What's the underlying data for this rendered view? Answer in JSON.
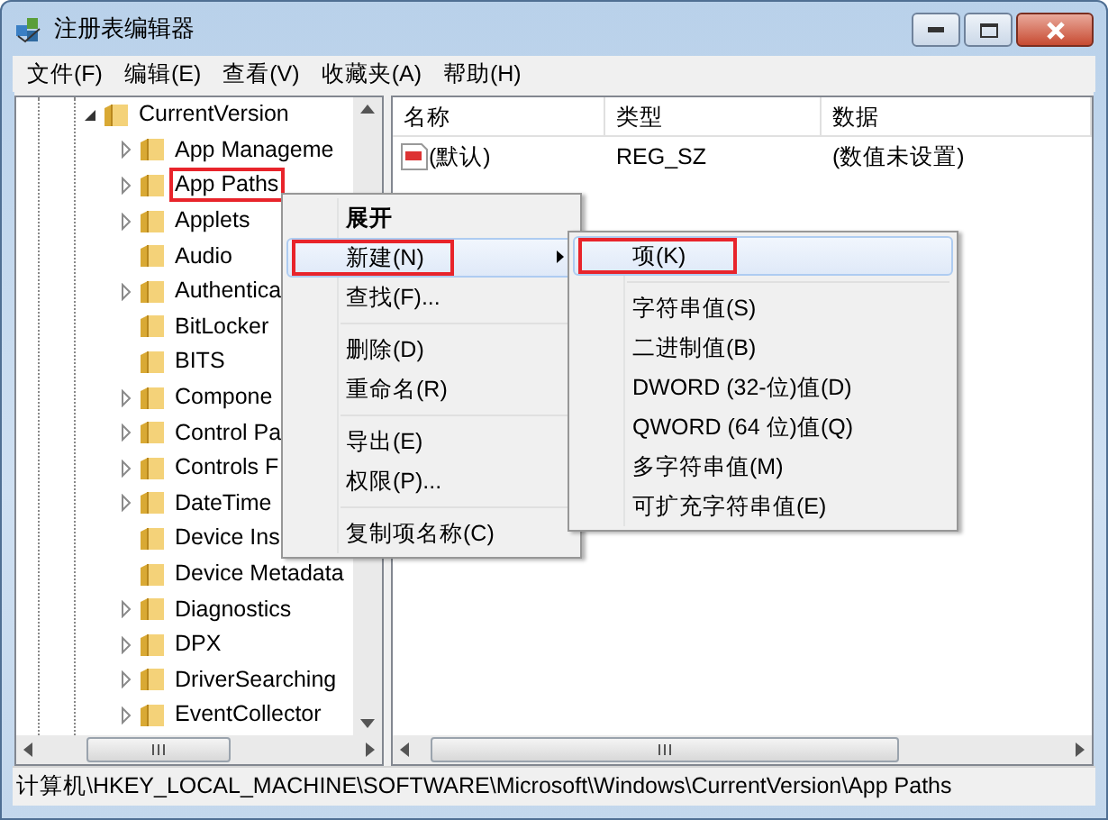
{
  "window": {
    "title": "注册表编辑器"
  },
  "menu_bar": [
    "文件(F)",
    "编辑(E)",
    "查看(V)",
    "收藏夹(A)",
    "帮助(H)"
  ],
  "tree": {
    "items": [
      {
        "label": "CurrentVersion",
        "expanded": true,
        "has_children": true,
        "annotated": false,
        "children": [
          {
            "label": "App Manageme",
            "has_children": true,
            "annotated": false
          },
          {
            "label": "App Paths",
            "has_children": true,
            "annotated": true
          },
          {
            "label": "Applets",
            "has_children": true,
            "annotated": false
          },
          {
            "label": "Audio",
            "has_children": false,
            "annotated": false
          },
          {
            "label": "Authentica",
            "has_children": true,
            "annotated": false
          },
          {
            "label": "BitLocker",
            "has_children": false,
            "annotated": false
          },
          {
            "label": "BITS",
            "has_children": false,
            "annotated": false
          },
          {
            "label": "Compone",
            "has_children": true,
            "annotated": false
          },
          {
            "label": "Control Pa",
            "has_children": true,
            "annotated": false
          },
          {
            "label": "Controls F",
            "has_children": true,
            "annotated": false
          },
          {
            "label": "DateTime",
            "has_children": true,
            "annotated": false
          },
          {
            "label": "Device Ins",
            "has_children": false,
            "annotated": false
          },
          {
            "label": "Device Metadata",
            "has_children": false,
            "annotated": false
          },
          {
            "label": "Diagnostics",
            "has_children": true,
            "annotated": false
          },
          {
            "label": "DPX",
            "has_children": true,
            "annotated": false
          },
          {
            "label": "DriverSearching",
            "has_children": true,
            "annotated": false
          },
          {
            "label": "EventCollector",
            "has_children": true,
            "annotated": false
          }
        ]
      }
    ]
  },
  "values": {
    "columns": [
      "名称",
      "类型",
      "数据"
    ],
    "rows": [
      {
        "name": "(默认)",
        "type": "REG_SZ",
        "data": "(数值未设置)"
      }
    ]
  },
  "context_menu": {
    "items": [
      {
        "kind": "item",
        "label": "展开",
        "default": true,
        "hover": false,
        "has_submenu": false,
        "annotated": false
      },
      {
        "kind": "item",
        "label": "新建(N)",
        "default": false,
        "hover": true,
        "has_submenu": true,
        "annotated": true
      },
      {
        "kind": "item",
        "label": "查找(F)...",
        "default": false,
        "hover": false,
        "has_submenu": false,
        "annotated": false
      },
      {
        "kind": "separator"
      },
      {
        "kind": "item",
        "label": "删除(D)",
        "default": false,
        "hover": false,
        "has_submenu": false,
        "annotated": false
      },
      {
        "kind": "item",
        "label": "重命名(R)",
        "default": false,
        "hover": false,
        "has_submenu": false,
        "annotated": false
      },
      {
        "kind": "separator"
      },
      {
        "kind": "item",
        "label": "导出(E)",
        "default": false,
        "hover": false,
        "has_submenu": false,
        "annotated": false
      },
      {
        "kind": "item",
        "label": "权限(P)...",
        "default": false,
        "hover": false,
        "has_submenu": false,
        "annotated": false
      },
      {
        "kind": "separator"
      },
      {
        "kind": "item",
        "label": "复制项名称(C)",
        "default": false,
        "hover": false,
        "has_submenu": false,
        "annotated": false
      }
    ]
  },
  "submenu": {
    "items": [
      {
        "kind": "item",
        "label": "项(K)",
        "default": false,
        "hover": true,
        "has_submenu": false,
        "annotated": true
      },
      {
        "kind": "separator"
      },
      {
        "kind": "item",
        "label": "字符串值(S)",
        "default": false,
        "hover": false,
        "has_submenu": false,
        "annotated": false
      },
      {
        "kind": "item",
        "label": "二进制值(B)",
        "default": false,
        "hover": false,
        "has_submenu": false,
        "annotated": false
      },
      {
        "kind": "item",
        "label": "DWORD (32-位)值(D)",
        "default": false,
        "hover": false,
        "has_submenu": false,
        "annotated": false
      },
      {
        "kind": "item",
        "label": "QWORD (64 位)值(Q)",
        "default": false,
        "hover": false,
        "has_submenu": false,
        "annotated": false
      },
      {
        "kind": "item",
        "label": "多字符串值(M)",
        "default": false,
        "hover": false,
        "has_submenu": false,
        "annotated": false
      },
      {
        "kind": "item",
        "label": "可扩充字符串值(E)",
        "default": false,
        "hover": false,
        "has_submenu": false,
        "annotated": false
      }
    ]
  },
  "status_bar": "计算机\\HKEY_LOCAL_MACHINE\\SOFTWARE\\Microsoft\\Windows\\CurrentVersion\\App Paths"
}
